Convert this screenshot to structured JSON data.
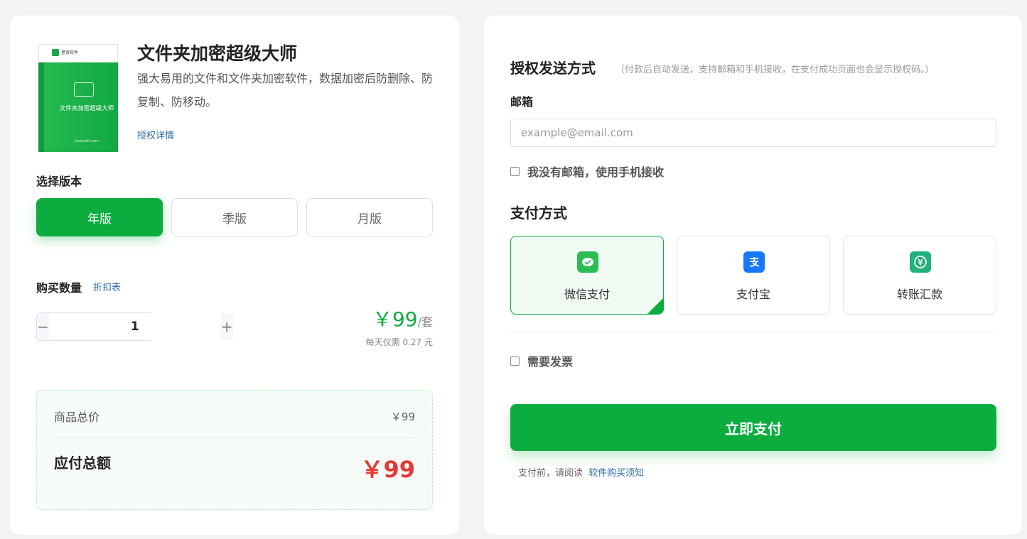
{
  "product": {
    "box_brand": "星奇软件",
    "box_title": "文件夹加密超级大师",
    "box_site": "jiamisoft.com",
    "title": "文件夹加密超级大师",
    "description": "强大易用的文件和文件夹加密软件，数据加密后防删除、防复制、防移动。",
    "auth_link": "授权详情"
  },
  "versions": {
    "label": "选择版本",
    "options": [
      "年版",
      "季版",
      "月版"
    ],
    "selected": "年版"
  },
  "quantity": {
    "label": "购买数量",
    "discount_link": "折扣表",
    "minus": "−",
    "plus": "+",
    "value": "1"
  },
  "pricing": {
    "unit_price": "￥99",
    "unit": "/套",
    "per_day": "每天仅需 0.27 元",
    "subtotal_label": "商品总价",
    "subtotal_value": "￥99",
    "total_label": "应付总额",
    "total_value": "￥99"
  },
  "delivery": {
    "title": "授权发送方式",
    "note": "（付款后自动发送，支持邮箱和手机接收，在支付成功页面也会显示授权码。）",
    "email_label": "邮箱",
    "email_placeholder": "example@email.com",
    "no_email_label": "我没有邮箱，使用手机接收"
  },
  "payment": {
    "title": "支付方式",
    "options": [
      {
        "label": "微信支付",
        "icon": "wechat-pay-icon",
        "color": "#2bbd52"
      },
      {
        "label": "支付宝",
        "icon": "alipay-icon",
        "color": "#1677ff"
      },
      {
        "label": "转账汇款",
        "icon": "bank-transfer-icon",
        "color": "#22b07d"
      }
    ],
    "selected": "微信支付",
    "invoice_label": "需要发票",
    "pay_button": "立即支付",
    "agree_prefix": "支付前，请阅读",
    "agree_link": "软件购买须知"
  },
  "colors": {
    "accent": "#0cac3f",
    "price_red": "#e53935",
    "link_blue": "#2b6cb0"
  }
}
